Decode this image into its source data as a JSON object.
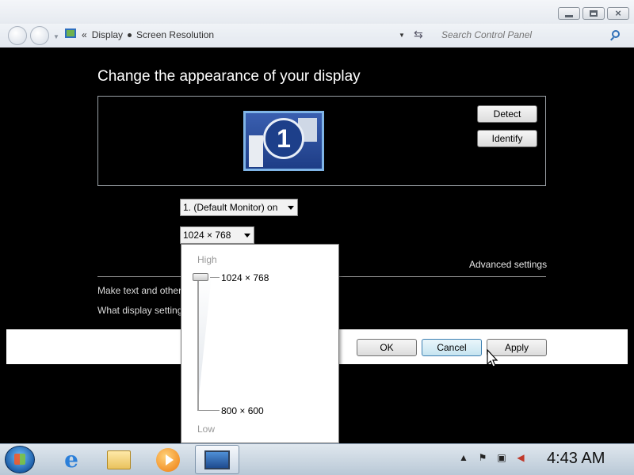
{
  "window": {
    "minimize_icon": "minimize-icon",
    "maximize_icon": "maximize-icon",
    "close_icon": "close-icon"
  },
  "address_bar": {
    "chevrons": "«",
    "breadcrumb": [
      "Display",
      "Screen Resolution"
    ],
    "search_placeholder": "Search Control Panel"
  },
  "main": {
    "title": "Change the appearance of your display",
    "monitor_number": "1",
    "detect_label": "Detect",
    "identify_label": "Identify",
    "display_select_value": "1. (Default Monitor) on",
    "resolution_select_value": "1024 × 768",
    "advanced_settings": "Advanced settings",
    "link_text_size": "Make text and other",
    "link_display_settings": "What display setting"
  },
  "buttons": {
    "ok": "OK",
    "cancel": "Cancel",
    "apply": "Apply"
  },
  "resolution_slider": {
    "high_label": "High",
    "low_label": "Low",
    "top_value": "1024 × 768",
    "bottom_value": "800 × 600",
    "selected": "1024 × 768"
  },
  "taskbar": {
    "items": [
      "internet-explorer-icon",
      "windows-explorer-icon",
      "media-player-icon",
      "display-settings-icon"
    ],
    "clock": "4:43 AM"
  }
}
